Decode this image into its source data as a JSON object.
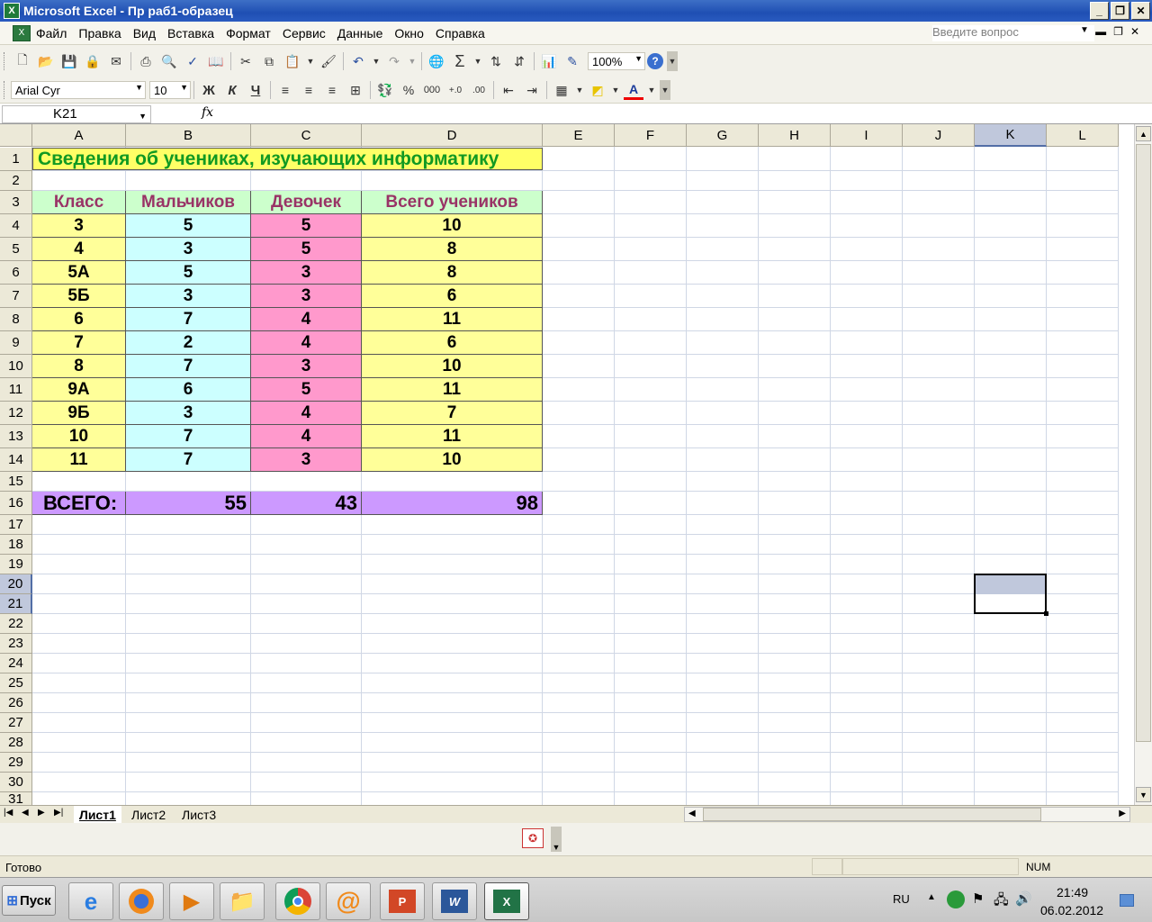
{
  "window": {
    "title": "Microsoft Excel - Пр раб1-образец"
  },
  "menu": {
    "items": [
      "Файл",
      "Правка",
      "Вид",
      "Вставка",
      "Формат",
      "Сервис",
      "Данные",
      "Окно",
      "Справка"
    ],
    "help_placeholder": "Введите вопрос"
  },
  "toolbar": {
    "zoom": "100%",
    "font_name": "Arial Cyr",
    "font_size": "10",
    "bold": "Ж",
    "italic": "К",
    "underline": "Ч",
    "percent": "%",
    "thousands": "000"
  },
  "formula_bar": {
    "name_box": "K21",
    "fx": "fx",
    "content": ""
  },
  "columns": [
    "A",
    "B",
    "C",
    "D",
    "E",
    "F",
    "G",
    "H",
    "I",
    "J",
    "K",
    "L"
  ],
  "rows": [
    "1",
    "2",
    "3",
    "4",
    "5",
    "6",
    "7",
    "8",
    "9",
    "10",
    "11",
    "12",
    "13",
    "14",
    "15",
    "16",
    "17",
    "18",
    "19",
    "20",
    "21",
    "22",
    "23",
    "24",
    "25",
    "26",
    "27",
    "28",
    "29",
    "30",
    "31"
  ],
  "table": {
    "title": "Сведения об учениках, изучающих информатику",
    "headers": [
      "Класс",
      "Мальчиков",
      "Девочек",
      "Всего учеников"
    ],
    "rows": [
      [
        "3",
        "5",
        "5",
        "10"
      ],
      [
        "4",
        "3",
        "5",
        "8"
      ],
      [
        "5А",
        "5",
        "3",
        "8"
      ],
      [
        "5Б",
        "3",
        "3",
        "6"
      ],
      [
        "6",
        "7",
        "4",
        "11"
      ],
      [
        "7",
        "2",
        "4",
        "6"
      ],
      [
        "8",
        "7",
        "3",
        "10"
      ],
      [
        "9А",
        "6",
        "5",
        "11"
      ],
      [
        "9Б",
        "3",
        "4",
        "7"
      ],
      [
        "10",
        "7",
        "4",
        "11"
      ],
      [
        "11",
        "7",
        "3",
        "10"
      ]
    ],
    "total": [
      "ВСЕГО:",
      "55",
      "43",
      "98"
    ]
  },
  "colors": {
    "title_bg": "#ffff66",
    "title_text": "#119922",
    "header_bg": "#ccffcc",
    "header_text": "#993366",
    "class_bg": "#ffff99",
    "boys_bg": "#ccffff",
    "girls_bg": "#ff99cc",
    "total_bg": "#cc99ff"
  },
  "sheets": [
    "Лист1",
    "Лист2",
    "Лист3"
  ],
  "status": {
    "ready": "Готово",
    "num": "NUM"
  },
  "taskbar": {
    "start": "Пуск",
    "lang": "RU",
    "time": "21:49",
    "date": "06.02.2012"
  }
}
